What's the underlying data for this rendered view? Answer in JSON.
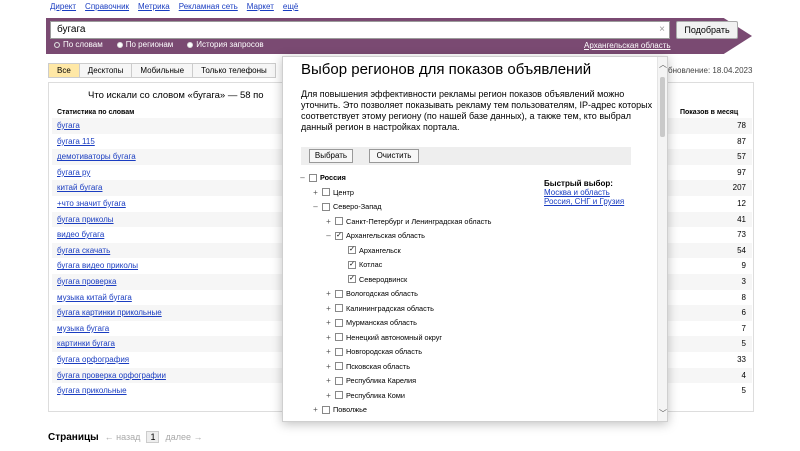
{
  "topnav": [
    "Директ",
    "Справочник",
    "Метрика",
    "Рекламная сеть",
    "Маркет",
    "ещё"
  ],
  "search": {
    "value": "бугага",
    "clear_icon": "×",
    "submit_label": "Подобрать"
  },
  "radios": [
    {
      "label": "По словам",
      "selected": true
    },
    {
      "label": "По регионам",
      "selected": false
    },
    {
      "label": "История запросов",
      "selected": false
    }
  ],
  "region_link": "Архангельская область",
  "tabs": [
    {
      "label": "Все",
      "active": true
    },
    {
      "label": "Десктопы",
      "active": false
    },
    {
      "label": "Мобильные",
      "active": false
    },
    {
      "label": "Только телефоны",
      "active": false
    }
  ],
  "updated": "бновление: 18.04.2023",
  "results": {
    "title": "Что искали со словом «бугага» — 58 по",
    "col_left": "Статистика по словам",
    "col_right": "Показов в месяц",
    "rows": [
      {
        "q": "бугага",
        "n": "78"
      },
      {
        "q": "бугага 115",
        "n": "87"
      },
      {
        "q": "демотиваторы бугага",
        "n": "57"
      },
      {
        "q": "бугага ру",
        "n": "97"
      },
      {
        "q": "китай бугага",
        "n": "207"
      },
      {
        "q": "+что значит бугага",
        "n": "12"
      },
      {
        "q": "бугага приколы",
        "n": "41"
      },
      {
        "q": "видео бугага",
        "n": "73"
      },
      {
        "q": "бугага скачать",
        "n": "54"
      },
      {
        "q": "бугага видео приколы",
        "n": "9"
      },
      {
        "q": "бугага проверка",
        "n": "3"
      },
      {
        "q": "музыка китай бугага",
        "n": "8"
      },
      {
        "q": "бугага картинки прикольные",
        "n": "6"
      },
      {
        "q": "музыка бугага",
        "n": "7"
      },
      {
        "q": "картинки бугага",
        "n": "5"
      },
      {
        "q": "бугага орфография",
        "n": "33"
      },
      {
        "q": "бугага проверка орфографии",
        "n": "4"
      },
      {
        "q": "бугага прикольные",
        "n": "5"
      }
    ]
  },
  "pager": {
    "label": "Страницы",
    "prev": "← назад",
    "current": "1",
    "next": "далее →"
  },
  "modal": {
    "title": "Выбор регионов для показов объявлений",
    "desc": "Для повышения эффективности рекламы регион показов объявлений можно уточнить. Это позволяет показывать рекламу тем пользователям, IP-адрес которых соответствует этому региону (по нашей базе данных), а также тем, кто выбрал данный регион в настройках портала.",
    "select_label": "Выбрать",
    "clear_label": "Очистить",
    "quick_title": "Быстрый выбор:",
    "quick_links": [
      "Москва и область",
      "Россия, СНГ и Грузия"
    ],
    "tree": [
      {
        "label": "Россия",
        "toggle": "–",
        "checked": false,
        "bold": true,
        "depth": 0
      },
      {
        "label": "Центр",
        "toggle": "+",
        "checked": false,
        "bold": false,
        "depth": 1
      },
      {
        "label": "Северо-Запад",
        "toggle": "–",
        "checked": false,
        "bold": false,
        "depth": 1
      },
      {
        "label": "Санкт-Петербург и Ленинградская область",
        "toggle": "+",
        "checked": false,
        "bold": false,
        "depth": 2
      },
      {
        "label": "Архангельская область",
        "toggle": "–",
        "checked": true,
        "bold": false,
        "depth": 2
      },
      {
        "label": "Архангельск",
        "toggle": "",
        "checked": true,
        "bold": false,
        "depth": 3
      },
      {
        "label": "Котлас",
        "toggle": "",
        "checked": true,
        "bold": false,
        "depth": 3
      },
      {
        "label": "Северодвинск",
        "toggle": "",
        "checked": true,
        "bold": false,
        "depth": 3
      },
      {
        "label": "Вологодская область",
        "toggle": "+",
        "checked": false,
        "bold": false,
        "depth": 2
      },
      {
        "label": "Калининградская область",
        "toggle": "+",
        "checked": false,
        "bold": false,
        "depth": 2
      },
      {
        "label": "Мурманская область",
        "toggle": "+",
        "checked": false,
        "bold": false,
        "depth": 2
      },
      {
        "label": "Ненецкий автономный округ",
        "toggle": "+",
        "checked": false,
        "bold": false,
        "depth": 2
      },
      {
        "label": "Новгородская область",
        "toggle": "+",
        "checked": false,
        "bold": false,
        "depth": 2
      },
      {
        "label": "Псковская область",
        "toggle": "+",
        "checked": false,
        "bold": false,
        "depth": 2
      },
      {
        "label": "Республика Карелия",
        "toggle": "+",
        "checked": false,
        "bold": false,
        "depth": 2
      },
      {
        "label": "Республика Коми",
        "toggle": "+",
        "checked": false,
        "bold": false,
        "depth": 2
      },
      {
        "label": "Поволжье",
        "toggle": "+",
        "checked": false,
        "bold": false,
        "depth": 1
      }
    ]
  },
  "colors": {
    "brand": "#7a4a72",
    "link": "#1a3dc1",
    "active_tab": "#ffe8a6"
  }
}
